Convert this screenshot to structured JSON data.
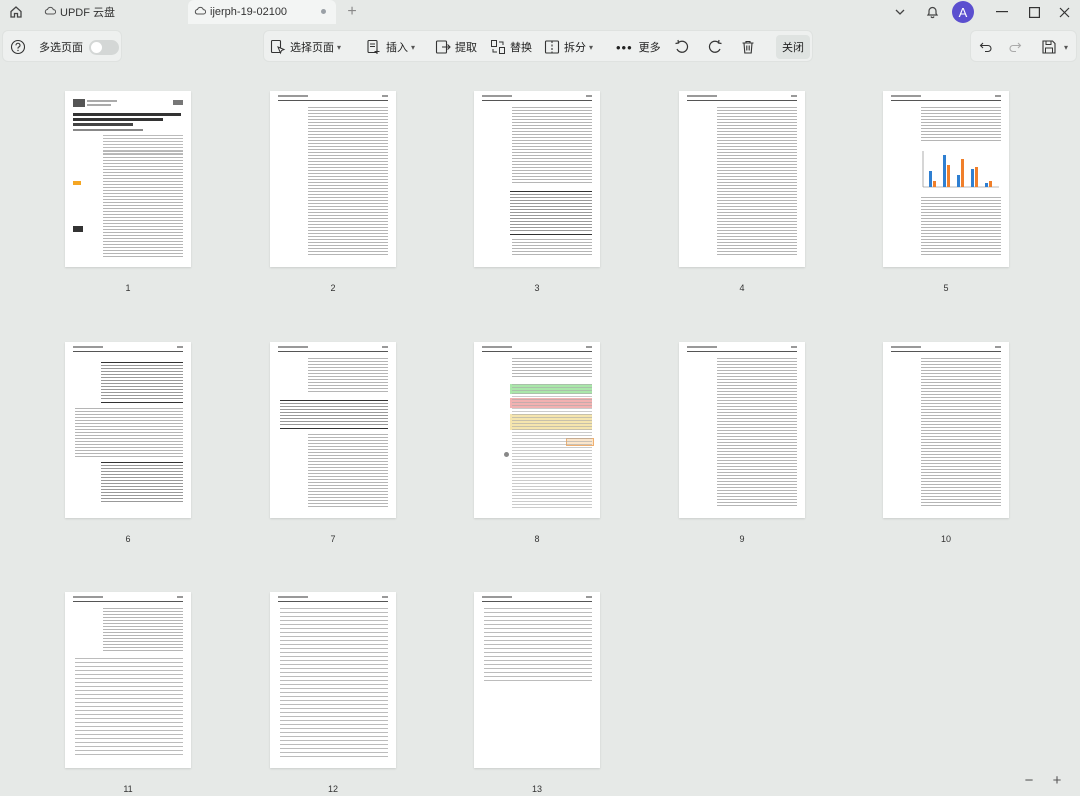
{
  "titlebar": {
    "tabs": [
      {
        "label": "UPDF 云盘"
      },
      {
        "label": "ijerph-19-02100"
      }
    ],
    "avatar_letter": "A"
  },
  "toolbar": {
    "multi_select_label": "多选页面",
    "tools": [
      {
        "label": "选择页面"
      },
      {
        "label": "插入"
      },
      {
        "label": "提取"
      },
      {
        "label": "替换"
      },
      {
        "label": "拆分"
      },
      {
        "label": "更多"
      }
    ],
    "close_label": "关闭"
  },
  "pages": [
    {
      "number": "1"
    },
    {
      "number": "2"
    },
    {
      "number": "3"
    },
    {
      "number": "4"
    },
    {
      "number": "5"
    },
    {
      "number": "6"
    },
    {
      "number": "7"
    },
    {
      "number": "8"
    },
    {
      "number": "9"
    },
    {
      "number": "10"
    },
    {
      "number": "11"
    },
    {
      "number": "12"
    },
    {
      "number": "13"
    }
  ],
  "zoom": {
    "minus": "−",
    "plus": "+"
  },
  "colors": {
    "accent": "#5b4fcf",
    "bar_blue": "#2f7fd1",
    "bar_orange": "#f07f2a",
    "highlight_green": "#9be39b",
    "highlight_red": "#f0a3a3",
    "highlight_yellow": "#f3e0a0"
  }
}
